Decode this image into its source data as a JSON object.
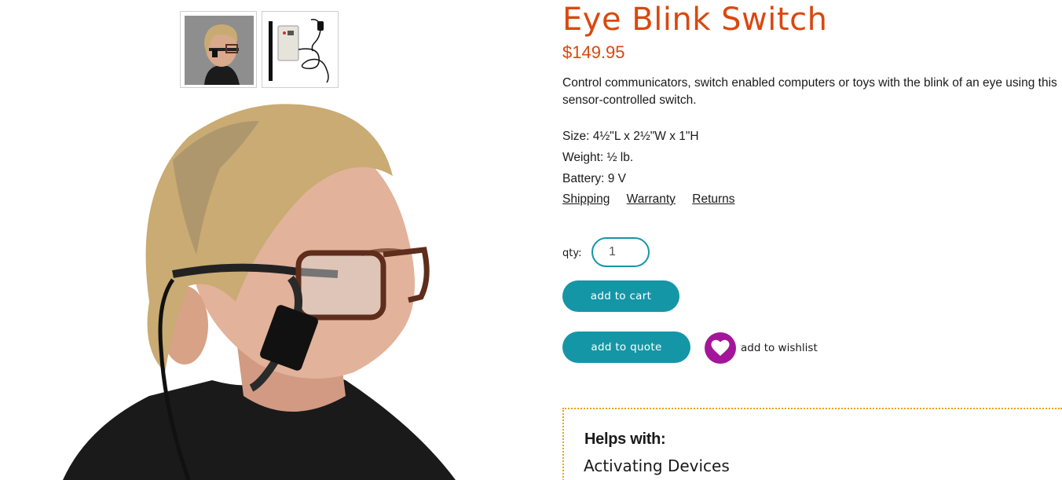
{
  "product": {
    "title": "Eye Blink Switch",
    "price": "$149.95",
    "description": "Control communicators, switch enabled computers or toys with the blink of an eye using this sensor-controlled switch.",
    "specs": {
      "size": "Size: 4½\"L x 2½\"W x 1\"H",
      "weight": "Weight: ½ lb.",
      "battery": "Battery: 9 V"
    }
  },
  "links": {
    "shipping": "Shipping",
    "warranty": "Warranty",
    "returns": "Returns"
  },
  "purchase": {
    "qty_label": "qty:",
    "qty_value": "1",
    "add_to_cart": "add to cart",
    "add_to_quote": "add to quote",
    "add_to_wishlist": "add to wishlist"
  },
  "helps": {
    "title": "Helps with:",
    "item": "Activating Devices"
  },
  "colors": {
    "accent": "#1596a6",
    "title": "#d9480f",
    "wishlist": "#a3169a",
    "border": "#e8a21a"
  },
  "icons": {
    "wishlist": "heart-icon"
  }
}
